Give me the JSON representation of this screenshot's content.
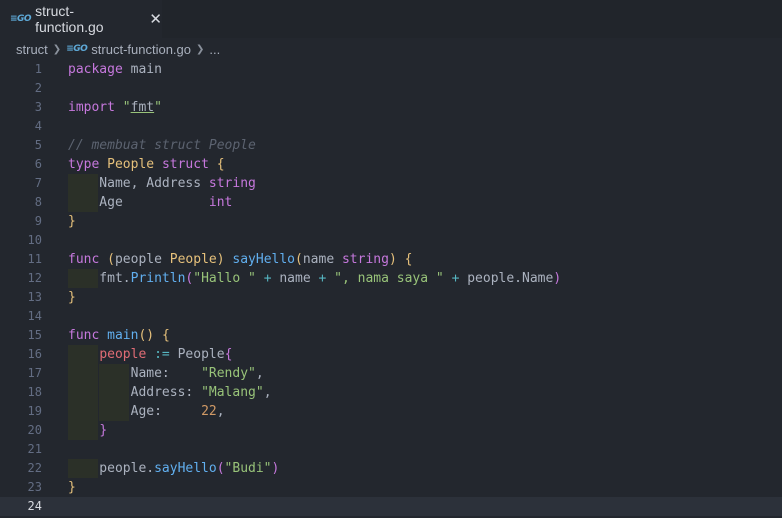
{
  "tab": {
    "icon": "go-file-icon",
    "label": "struct-function.go",
    "close_icon": "close-icon"
  },
  "breadcrumb": {
    "folder": "struct",
    "file": "struct-function.go",
    "more": "..."
  },
  "editor": {
    "current_line": 24,
    "lines": [
      {
        "n": "1",
        "tokens": [
          [
            "kw",
            "package"
          ],
          [
            "pl",
            " main"
          ]
        ]
      },
      {
        "n": "2",
        "tokens": []
      },
      {
        "n": "3",
        "tokens": [
          [
            "kw",
            "import"
          ],
          [
            "pl",
            " "
          ],
          [
            "st",
            "\""
          ],
          [
            "sq",
            "fmt"
          ],
          [
            "st",
            "\""
          ]
        ]
      },
      {
        "n": "4",
        "tokens": []
      },
      {
        "n": "5",
        "tokens": [
          [
            "cm",
            "// membuat struct People"
          ]
        ]
      },
      {
        "n": "6",
        "tokens": [
          [
            "kw",
            "type"
          ],
          [
            "pl",
            " "
          ],
          [
            "ty",
            "People"
          ],
          [
            "pl",
            " "
          ],
          [
            "kw",
            "struct"
          ],
          [
            "pl",
            " "
          ],
          [
            "br",
            "{"
          ]
        ]
      },
      {
        "n": "7",
        "indent": 1,
        "tokens": [
          [
            "pl",
            "    Name, Address "
          ],
          [
            "kw",
            "string"
          ]
        ]
      },
      {
        "n": "8",
        "indent": 1,
        "tokens": [
          [
            "pl",
            "    Age           "
          ],
          [
            "kw",
            "int"
          ]
        ]
      },
      {
        "n": "9",
        "tokens": [
          [
            "br",
            "}"
          ]
        ]
      },
      {
        "n": "10",
        "tokens": []
      },
      {
        "n": "11",
        "tokens": [
          [
            "kw",
            "func"
          ],
          [
            "pl",
            " "
          ],
          [
            "br",
            "("
          ],
          [
            "pl",
            "people "
          ],
          [
            "ty",
            "People"
          ],
          [
            "br",
            ")"
          ],
          [
            "pl",
            " "
          ],
          [
            "fn",
            "sayHello"
          ],
          [
            "br",
            "("
          ],
          [
            "pl",
            "name "
          ],
          [
            "kw",
            "string"
          ],
          [
            "br",
            ")"
          ],
          [
            "pl",
            " "
          ],
          [
            "br",
            "{"
          ]
        ]
      },
      {
        "n": "12",
        "indent": 1,
        "tokens": [
          [
            "pl",
            "    fmt."
          ],
          [
            "fn",
            "Println"
          ],
          [
            "bp",
            "("
          ],
          [
            "st",
            "\"Hallo \""
          ],
          [
            "pl",
            " "
          ],
          [
            "op",
            "+"
          ],
          [
            "pl",
            " name "
          ],
          [
            "op",
            "+"
          ],
          [
            "pl",
            " "
          ],
          [
            "st",
            "\", nama saya \""
          ],
          [
            "pl",
            " "
          ],
          [
            "op",
            "+"
          ],
          [
            "pl",
            " people.Name"
          ],
          [
            "bp",
            ")"
          ]
        ]
      },
      {
        "n": "13",
        "tokens": [
          [
            "br",
            "}"
          ]
        ]
      },
      {
        "n": "14",
        "tokens": []
      },
      {
        "n": "15",
        "tokens": [
          [
            "kw",
            "func"
          ],
          [
            "pl",
            " "
          ],
          [
            "fn",
            "main"
          ],
          [
            "br",
            "()"
          ],
          [
            "pl",
            " "
          ],
          [
            "br",
            "{"
          ]
        ]
      },
      {
        "n": "16",
        "indent": 1,
        "tokens": [
          [
            "pl",
            "    "
          ],
          [
            "vr",
            "people"
          ],
          [
            "pl",
            " "
          ],
          [
            "op",
            ":="
          ],
          [
            "pl",
            " People"
          ],
          [
            "bp",
            "{"
          ]
        ]
      },
      {
        "n": "17",
        "indent": 2,
        "tokens": [
          [
            "pl",
            "        Name:    "
          ],
          [
            "st",
            "\"Rendy\""
          ],
          [
            "pl",
            ","
          ]
        ]
      },
      {
        "n": "18",
        "indent": 2,
        "tokens": [
          [
            "pl",
            "        Address: "
          ],
          [
            "st",
            "\"Malang\""
          ],
          [
            "pl",
            ","
          ]
        ]
      },
      {
        "n": "19",
        "indent": 2,
        "tokens": [
          [
            "pl",
            "        Age:     "
          ],
          [
            "nu",
            "22"
          ],
          [
            "pl",
            ","
          ]
        ]
      },
      {
        "n": "20",
        "indent": 1,
        "tokens": [
          [
            "pl",
            "    "
          ],
          [
            "bp",
            "}"
          ]
        ]
      },
      {
        "n": "21",
        "tokens": []
      },
      {
        "n": "22",
        "indent": 1,
        "tokens": [
          [
            "pl",
            "    people."
          ],
          [
            "fn",
            "sayHello"
          ],
          [
            "bp",
            "("
          ],
          [
            "st",
            "\"Budi\""
          ],
          [
            "bp",
            ")"
          ]
        ]
      },
      {
        "n": "23",
        "tokens": [
          [
            "br",
            "}"
          ]
        ]
      },
      {
        "n": "24",
        "tokens": []
      }
    ]
  }
}
